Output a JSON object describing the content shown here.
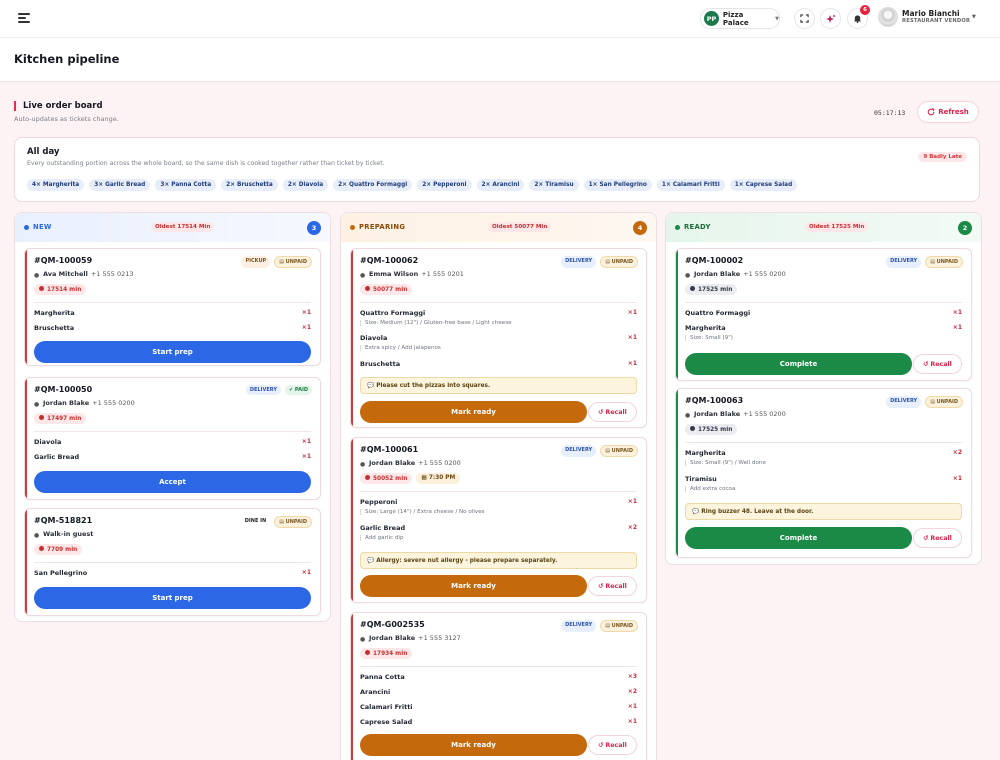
{
  "colors": {
    "accent_red": "#d8234b",
    "new": "#2c68e6",
    "preparing": "#c5690d",
    "ready": "#1b8a47"
  },
  "topbar": {
    "menu_icon": "hamburger-icon",
    "store": {
      "initials": "PP",
      "name": "Pizza Palace"
    },
    "notification_count": "6",
    "user": {
      "name": "Mario Bianchi",
      "role": "RESTAURANT VENDOR"
    }
  },
  "page": {
    "title": "Kitchen pipeline"
  },
  "board": {
    "title": "Live order board",
    "subtitle": "Auto-updates as tickets change.",
    "clock": "05:17:13",
    "refresh_label": "Refresh"
  },
  "all_day": {
    "title": "All day",
    "subtitle": "Every outstanding portion across the whole board, so the same dish is cooked together rather than ticket by ticket.",
    "late_label": "9 Badly Late",
    "items": [
      "4× Margherita",
      "3× Garlic Bread",
      "3× Panna Cotta",
      "2× Bruschetta",
      "2× Diavola",
      "2× Quattro Formaggi",
      "2× Pepperoni",
      "2× Arancini",
      "2× Tiramisu",
      "1× San Pellegrino",
      "1× Calamari Fritti",
      "1× Caprese Salad"
    ]
  },
  "columns": {
    "new": {
      "name": "NEW",
      "oldest": "Oldest 17514 Min",
      "count": "3",
      "orders": [
        {
          "id": "#QM-100059",
          "tags": [
            "PICKUP",
            "UNPAID"
          ],
          "customer": "Ava Mitchell",
          "phone": "+1 555 0213",
          "time": "17514 min",
          "items": [
            {
              "name": "Margherita",
              "qty": "×1"
            },
            {
              "name": "Bruschetta",
              "qty": "×1"
            }
          ],
          "action": "Start prep"
        },
        {
          "id": "#QM-100050",
          "tags": [
            "DELIVERY",
            "PAID"
          ],
          "customer": "Jordan Blake",
          "phone": "+1 555 0200",
          "time": "17497 min",
          "items": [
            {
              "name": "Diavola",
              "qty": "×1"
            },
            {
              "name": "Garlic Bread",
              "qty": "×1"
            }
          ],
          "action": "Accept"
        },
        {
          "id": "#QM-518821",
          "tags": [
            "DINE IN",
            "UNPAID"
          ],
          "customer": "Walk-in guest",
          "phone": "",
          "time": "7709 min",
          "items": [
            {
              "name": "San Pellegrino",
              "qty": "×1"
            }
          ],
          "action": "Start prep"
        }
      ]
    },
    "preparing": {
      "name": "PREPARING",
      "oldest": "Oldest 50077 Min",
      "count": "4",
      "orders": [
        {
          "id": "#QM-100062",
          "tags": [
            "DELIVERY",
            "UNPAID"
          ],
          "customer": "Emma Wilson",
          "phone": "+1 555 0201",
          "time": "50077 min",
          "items": [
            {
              "name": "Quattro Formaggi",
              "qty": "×1",
              "mod": "Size: Medium (12\") / Gluten-free base / Light cheese"
            },
            {
              "name": "Diavola",
              "qty": "×1",
              "mod": "Extra spicy / Add jalapenos"
            },
            {
              "name": "Bruschetta",
              "qty": "×1"
            }
          ],
          "note": "Please cut the pizzas into squares.",
          "action": "Mark ready",
          "recall": "Recall"
        },
        {
          "id": "#QM-100061",
          "tags": [
            "DELIVERY",
            "UNPAID"
          ],
          "customer": "Jordan Blake",
          "phone": "+1 555 0200",
          "time": "50052 min",
          "scheduled": "7:30 PM",
          "items": [
            {
              "name": "Pepperoni",
              "qty": "×1",
              "mod": "Size: Large (14\") / Extra cheese / No olives"
            },
            {
              "name": "Garlic Bread",
              "qty": "×2",
              "mod": "Add garlic dip"
            }
          ],
          "note": "Allergy: severe nut allergy - please prepare separately.",
          "action": "Mark ready",
          "recall": "Recall"
        },
        {
          "id": "#QM-G002535",
          "tags": [
            "DELIVERY",
            "UNPAID"
          ],
          "customer": "Jordan Blake",
          "phone": "+1 555 3127",
          "time": "17934 min",
          "items": [
            {
              "name": "Panna Cotta",
              "qty": "×3"
            },
            {
              "name": "Arancini",
              "qty": "×2"
            },
            {
              "name": "Calamari Fritti",
              "qty": "×1"
            },
            {
              "name": "Caprese Salad",
              "qty": "×1"
            }
          ],
          "action": "Mark ready",
          "recall": "Recall"
        }
      ]
    },
    "ready": {
      "name": "READY",
      "oldest": "Oldest 17525 Min",
      "count": "2",
      "orders": [
        {
          "id": "#QM-100002",
          "tags": [
            "DELIVERY",
            "UNPAID"
          ],
          "customer": "Jordan Blake",
          "phone": "+1 555 0200",
          "time": "17525 min",
          "items": [
            {
              "name": "Quattro Formaggi",
              "qty": "×1"
            },
            {
              "name": "Margherita",
              "qty": "×1",
              "mod": "Size: Small (9\")"
            }
          ],
          "action": "Complete",
          "recall": "Recall"
        },
        {
          "id": "#QM-100063",
          "tags": [
            "DELIVERY",
            "UNPAID"
          ],
          "customer": "Jordan Blake",
          "phone": "+1 555 0200",
          "time": "17525 min",
          "items": [
            {
              "name": "Margherita",
              "qty": "×2",
              "mod": "Size: Small (9\") / Well done"
            },
            {
              "name": "Tiramisu",
              "qty": "×1",
              "mod": "Add extra cocoa"
            }
          ],
          "note": "Ring buzzer 48. Leave at the door.",
          "action": "Complete",
          "recall": "Recall"
        }
      ]
    }
  }
}
